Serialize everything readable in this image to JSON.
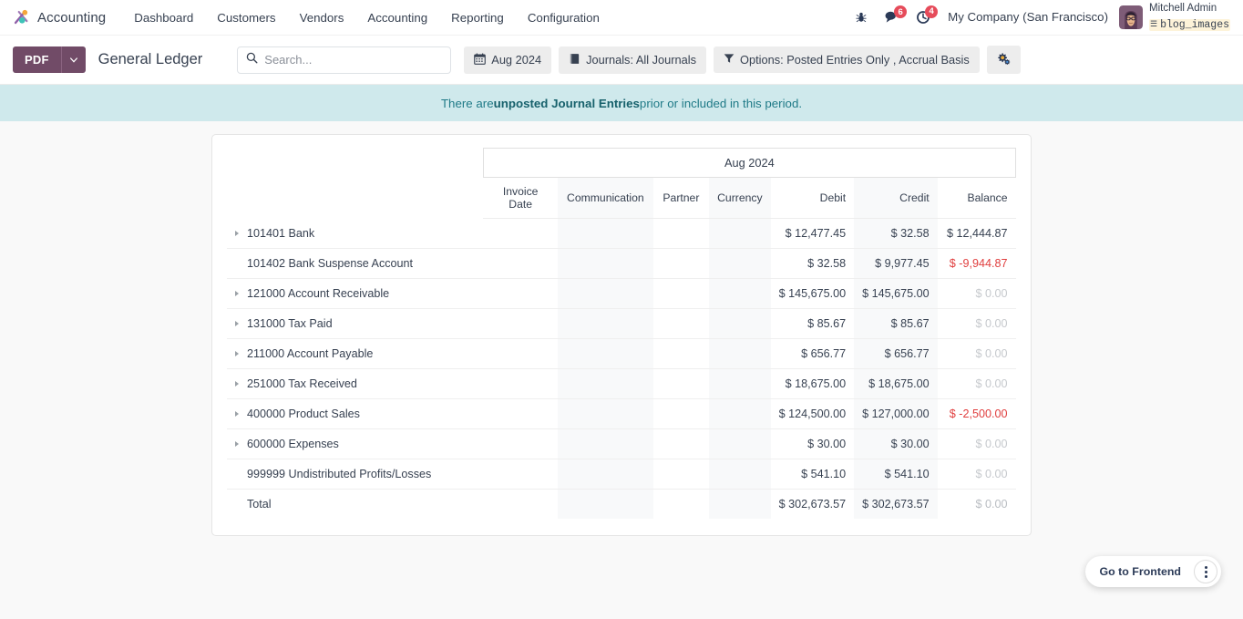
{
  "navbar": {
    "brand": "Accounting",
    "brand_logo_icon": "odoo-accounting-logo-icon",
    "links": [
      {
        "label": "Dashboard",
        "name": "dashboard"
      },
      {
        "label": "Customers",
        "name": "customers"
      },
      {
        "label": "Vendors",
        "name": "vendors"
      },
      {
        "label": "Accounting",
        "name": "accounting"
      },
      {
        "label": "Reporting",
        "name": "reporting"
      },
      {
        "label": "Configuration",
        "name": "configuration"
      }
    ],
    "systray": {
      "bug_icon": "bug-icon",
      "messages_icon": "chat-bubble-icon",
      "messages_count": "6",
      "activities_icon": "clock-icon",
      "activities_count": "4",
      "badge_color": "#E64B5A"
    },
    "company": "My Company (San Francisco)",
    "user": {
      "name": "Mitchell Admin",
      "database": "blog_images",
      "db_icon": "database-icon",
      "avatar_icon": "user-avatar"
    }
  },
  "control_panel": {
    "pdf_label": "PDF",
    "pdf_caret_icon": "chevron-down-icon",
    "pdf_color": "#714B67",
    "title": "General Ledger",
    "search": {
      "placeholder": "Search...",
      "value": "",
      "icon": "search-icon"
    },
    "filters": [
      {
        "label": "Aug 2024",
        "icon": "calendar-icon",
        "name": "date-filter"
      },
      {
        "label": "Journals: All Journals",
        "icon": "book-icon",
        "name": "journals-filter"
      },
      {
        "label": "Options: Posted Entries Only , Accrual Basis",
        "icon": "funnel-icon",
        "name": "options-filter"
      }
    ],
    "settings_icon": "gears-icon"
  },
  "banner": {
    "text_before": "There are ",
    "text_bold": "unposted Journal Entries",
    "text_after": " prior or included in this period.",
    "background": "#CFE9EC",
    "color": "#1F7A87"
  },
  "report": {
    "period_header": "Aug 2024",
    "columns": [
      {
        "label": "Invoice Date",
        "align": "center",
        "shaded": false
      },
      {
        "label": "Communication",
        "align": "center",
        "shaded": true
      },
      {
        "label": "Partner",
        "align": "center",
        "shaded": false
      },
      {
        "label": "Currency",
        "align": "center",
        "shaded": true
      },
      {
        "label": "Debit",
        "align": "right",
        "shaded": false
      },
      {
        "label": "Credit",
        "align": "right",
        "shaded": true
      },
      {
        "label": "Balance",
        "align": "right",
        "shaded": false
      }
    ],
    "rows": [
      {
        "name": "101401 Bank",
        "expandable": true,
        "debit": "$ 12,477.45",
        "credit": "$ 32.58",
        "balance": "$ 12,444.87",
        "balance_state": "normal"
      },
      {
        "name": "101402 Bank Suspense Account",
        "expandable": false,
        "debit": "$ 32.58",
        "credit": "$ 9,977.45",
        "balance": "$ -9,944.87",
        "balance_state": "negative"
      },
      {
        "name": "121000 Account Receivable",
        "expandable": true,
        "debit": "$ 145,675.00",
        "credit": "$ 145,675.00",
        "balance": "$ 0.00",
        "balance_state": "zero"
      },
      {
        "name": "131000 Tax Paid",
        "expandable": true,
        "debit": "$ 85.67",
        "credit": "$ 85.67",
        "balance": "$ 0.00",
        "balance_state": "zero"
      },
      {
        "name": "211000 Account Payable",
        "expandable": true,
        "debit": "$ 656.77",
        "credit": "$ 656.77",
        "balance": "$ 0.00",
        "balance_state": "zero"
      },
      {
        "name": "251000 Tax Received",
        "expandable": true,
        "debit": "$ 18,675.00",
        "credit": "$ 18,675.00",
        "balance": "$ 0.00",
        "balance_state": "zero"
      },
      {
        "name": "400000 Product Sales",
        "expandable": true,
        "debit": "$ 124,500.00",
        "credit": "$ 127,000.00",
        "balance": "$ -2,500.00",
        "balance_state": "negative"
      },
      {
        "name": "600000 Expenses",
        "expandable": true,
        "debit": "$ 30.00",
        "credit": "$ 30.00",
        "balance": "$ 0.00",
        "balance_state": "zero"
      },
      {
        "name": "999999 Undistributed Profits/Losses",
        "expandable": false,
        "debit": "$ 541.10",
        "credit": "$ 541.10",
        "balance": "$ 0.00",
        "balance_state": "zero"
      }
    ],
    "total": {
      "name": "Total",
      "debit": "$ 302,673.57",
      "credit": "$ 302,673.57",
      "balance": "$ 0.00",
      "balance_state": "zero"
    },
    "colors": {
      "negative": "#E03E3E",
      "zero": "#C6C9CD"
    }
  },
  "fab": {
    "label": "Go to Frontend",
    "menu_icon": "vertical-dots-icon"
  }
}
